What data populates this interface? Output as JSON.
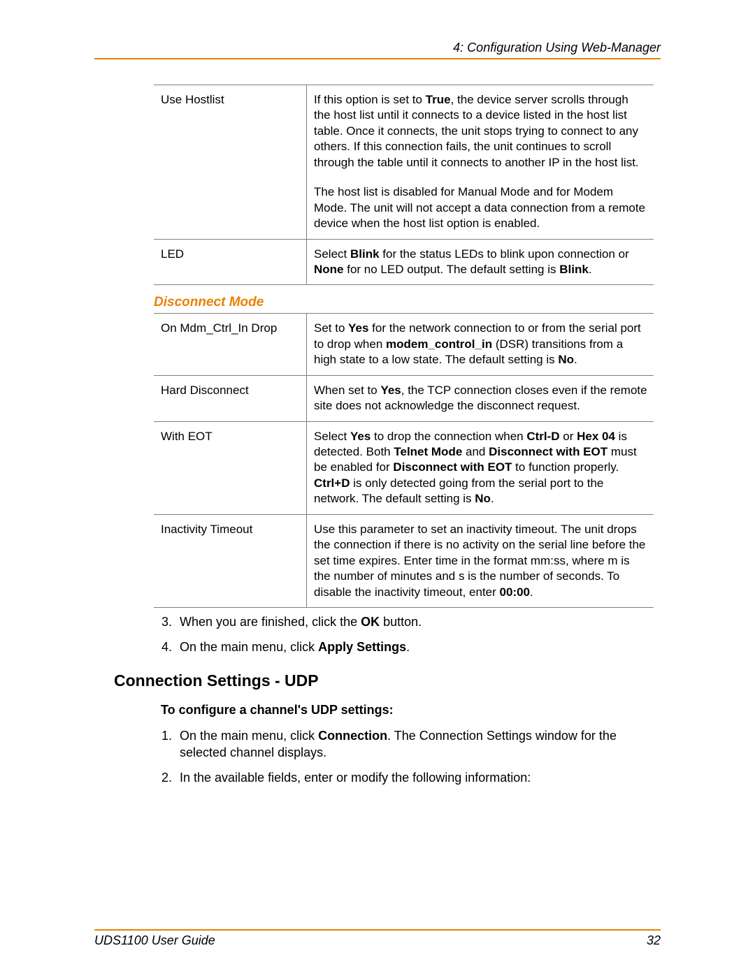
{
  "header": {
    "title": "4: Configuration Using Web-Manager"
  },
  "table1": {
    "rows": [
      {
        "name": "Use Hostlist",
        "desc_p1_a": "If this option is set to ",
        "desc_p1_b": "True",
        "desc_p1_c": ", the device server scrolls through the host list until it connects to a device listed in the host list table. Once it connects, the unit stops trying to connect to any others. If this connection fails, the unit continues to scroll through the table until it connects to another IP in the host list.",
        "desc_p2": "The host list is disabled for Manual Mode and for Modem Mode. The unit will not accept a data connection from a remote device when the host list option is enabled."
      },
      {
        "name": "LED",
        "desc_a": "Select ",
        "desc_b": "Blink",
        "desc_c": " for the status LEDs to blink upon connection or ",
        "desc_d": "None",
        "desc_e": " for no LED output. The default setting is ",
        "desc_f": "Blink",
        "desc_g": "."
      }
    ]
  },
  "section1": {
    "heading": "Disconnect Mode"
  },
  "table2": {
    "rows": [
      {
        "name": "On Mdm_Ctrl_In Drop",
        "a": "Set to ",
        "b": "Yes",
        "c": " for the network connection to or from the serial port to drop when ",
        "d": "modem_control_in",
        "e": " (DSR) transitions from a high state to a low state. The default setting is ",
        "f": "No",
        "g": "."
      },
      {
        "name": "Hard Disconnect",
        "a": "When set to ",
        "b": "Yes",
        "c": ", the TCP connection closes even if the remote site does not acknowledge the disconnect request."
      },
      {
        "name": "With EOT",
        "a": "Select ",
        "b": "Yes",
        "c": " to drop the connection when ",
        "d": "Ctrl-D",
        "e": " or ",
        "f": "Hex 04",
        "g": " is detected. Both ",
        "h": "Telnet Mode",
        "i": " and ",
        "j": "Disconnect with EOT",
        "k": " must be enabled for ",
        "l": "Disconnect with EOT",
        "m": " to function properly. ",
        "n": "Ctrl+D",
        "o": " is only detected going from the serial port to the network. The default setting is ",
        "p": "No",
        "q": "."
      },
      {
        "name": "Inactivity Timeout",
        "a": "Use this parameter to set an inactivity timeout. The unit drops the connection if there is no activity on the serial line before the set time expires. Enter time in the format mm:ss, where m is the number of minutes and s is the number of seconds. To disable the inactivity timeout, enter ",
        "b": "00:00",
        "c": "."
      }
    ]
  },
  "steps_a": {
    "s3_a": "When you are finished, click the ",
    "s3_b": "OK",
    "s3_c": " button.",
    "s4_a": "On the main menu, click ",
    "s4_b": "Apply Settings",
    "s4_c": "."
  },
  "section2": {
    "heading": "Connection Settings - UDP",
    "subheading": "To configure a channel's UDP settings:"
  },
  "steps_b": {
    "s1_a": "On the main menu, click ",
    "s1_b": "Connection",
    "s1_c": ". The Connection Settings window for the selected channel displays.",
    "s2": "In the available fields, enter or modify the following information:"
  },
  "footer": {
    "left": "UDS1100 User Guide",
    "right": "32"
  }
}
